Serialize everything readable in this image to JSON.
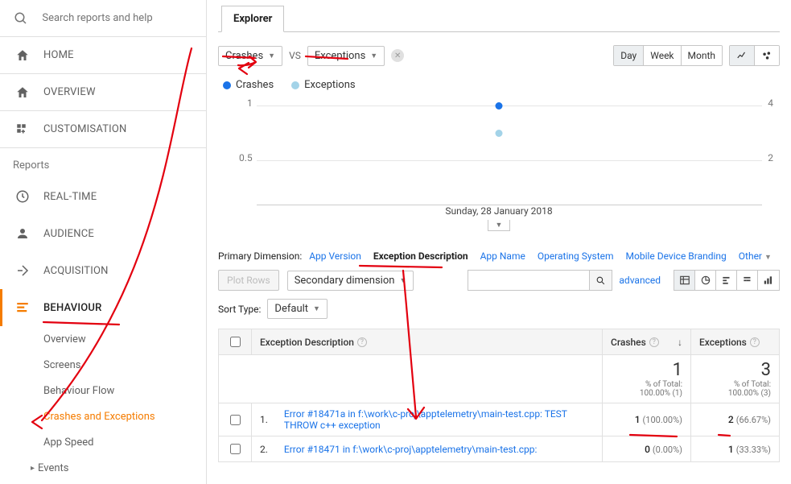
{
  "search": {
    "placeholder": "Search reports and help"
  },
  "nav": {
    "home": "HOME",
    "overview": "OVERVIEW",
    "customisation": "CUSTOMISATION",
    "reports_header": "Reports",
    "realtime": "REAL-TIME",
    "audience": "AUDIENCE",
    "acquisition": "ACQUISITION",
    "behaviour": "BEHAVIOUR",
    "behaviour_sub": {
      "overview": "Overview",
      "screens": "Screens",
      "behaviour_flow": "Behaviour Flow",
      "crashes_exceptions": "Crashes and Exceptions",
      "app_speed": "App Speed",
      "events": "Events"
    }
  },
  "tab": {
    "explorer": "Explorer"
  },
  "metrics": {
    "primary": "Crashes",
    "vs": "VS",
    "secondary": "Exceptions"
  },
  "time_buttons": {
    "day": "Day",
    "week": "Week",
    "month": "Month"
  },
  "legend": {
    "crashes": "Crashes",
    "exceptions": "Exceptions"
  },
  "chart_data": {
    "type": "scatter",
    "x": [
      "Sunday, 28 January 2018"
    ],
    "series": [
      {
        "name": "Crashes",
        "values": [
          1
        ],
        "color": "#1a73e8",
        "y_axis": "left"
      },
      {
        "name": "Exceptions",
        "values": [
          3
        ],
        "color": "#a3d3e8",
        "y_axis": "right"
      }
    ],
    "y_left": {
      "ticks": [
        0.5,
        1
      ],
      "max": 1
    },
    "y_right": {
      "ticks": [
        2,
        4
      ],
      "max": 4
    },
    "x_label": "Sunday, 28 January 2018"
  },
  "dimensions": {
    "label": "Primary Dimension:",
    "items": [
      "App Version",
      "Exception Description",
      "App Name",
      "Operating System",
      "Mobile Device Branding",
      "Other"
    ],
    "active_index": 1
  },
  "table_controls": {
    "plot_rows": "Plot Rows",
    "secondary_dimension": "Secondary dimension",
    "advanced": "advanced",
    "sort_type_label": "Sort Type:",
    "sort_type_value": "Default"
  },
  "table": {
    "header": {
      "exception_desc": "Exception Description",
      "crashes": "Crashes",
      "exceptions": "Exceptions"
    },
    "totals": {
      "crashes": {
        "value": "1",
        "pct_line": "% of Total:",
        "pct_value": "100.00% (1)"
      },
      "exceptions": {
        "value": "3",
        "pct_line": "% of Total:",
        "pct_value": "100.00% (3)"
      }
    },
    "rows": [
      {
        "idx": "1.",
        "desc": "Error #18471a in f:\\work\\c-proj\\apptelemetry\\main-test.cpp: TEST THROW c++ exception",
        "crashes": "1",
        "crashes_pct": "(100.00%)",
        "exceptions": "2",
        "exceptions_pct": "(66.67%)"
      },
      {
        "idx": "2.",
        "desc": "Error #18471 in f:\\work\\c-proj\\apptelemetry\\main-test.cpp:",
        "crashes": "0",
        "crashes_pct": "(0.00%)",
        "exceptions": "1",
        "exceptions_pct": "(33.33%)"
      }
    ]
  },
  "colors": {
    "primary": "#1a73e8",
    "secondary": "#a3d3e8",
    "accent": "#f57c00"
  }
}
